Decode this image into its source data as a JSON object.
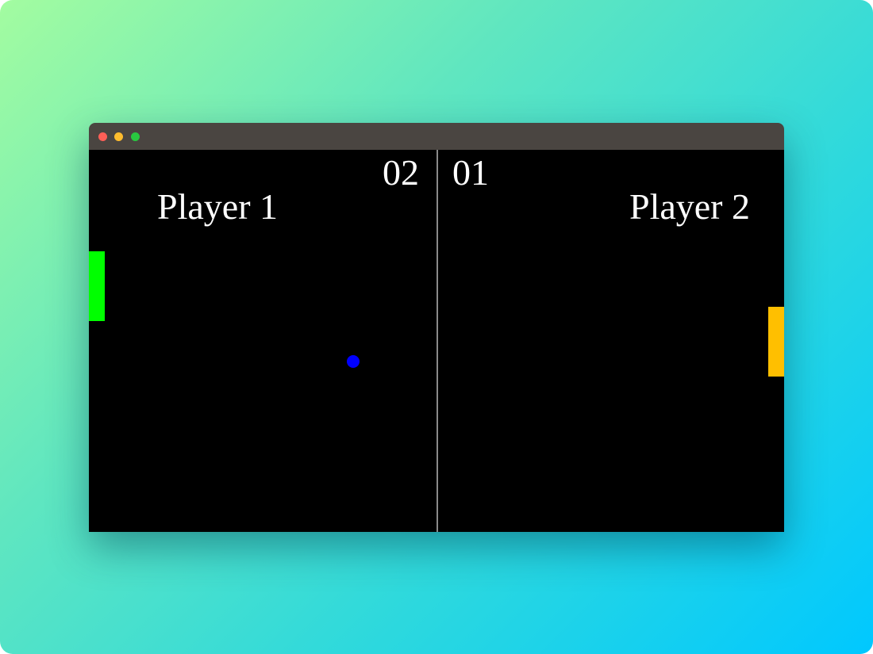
{
  "window": {
    "controls": [
      "close",
      "minimize",
      "zoom"
    ]
  },
  "game": {
    "player1": {
      "name": "Player 1",
      "score": "02",
      "paddle_color": "#00ff00"
    },
    "player2": {
      "name": "Player 2",
      "score": "01",
      "paddle_color": "#ffbf00"
    },
    "ball_color": "#0000ff",
    "court_color": "#000000",
    "net_color": "#8a8a8a"
  }
}
